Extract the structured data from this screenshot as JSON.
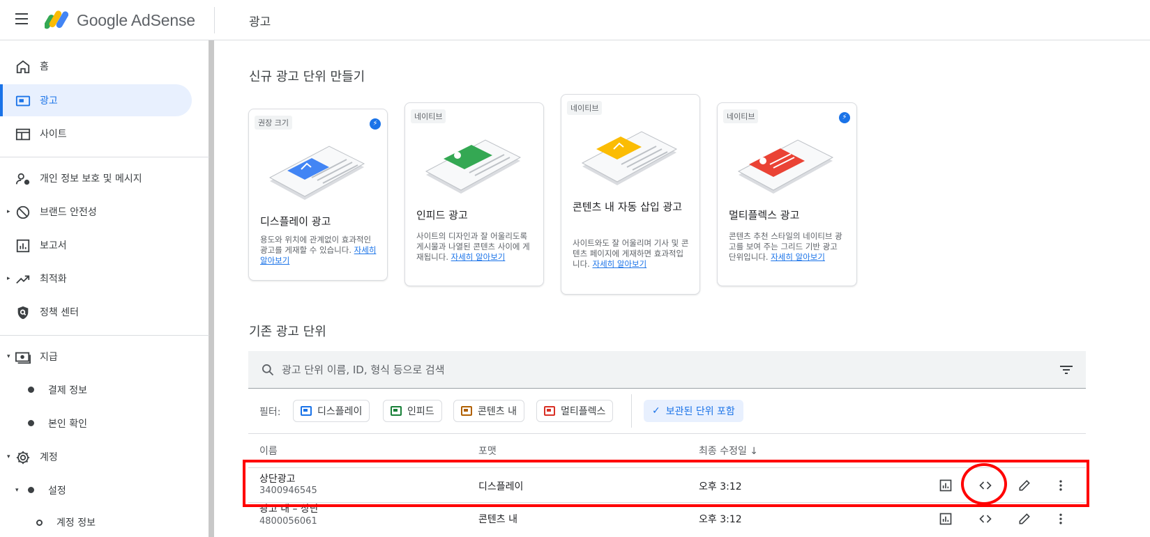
{
  "header": {
    "brand": "Google AdSense",
    "page_title": "광고"
  },
  "sidebar": {
    "items": [
      {
        "label": "홈",
        "icon": "home-icon"
      },
      {
        "label": "광고",
        "icon": "ads-icon",
        "active": true
      },
      {
        "label": "사이트",
        "icon": "sites-icon"
      },
      {
        "label": "개인 정보 보호 및 메시지",
        "icon": "privacy-icon"
      },
      {
        "label": "브랜드 안전성",
        "icon": "block-icon"
      },
      {
        "label": "보고서",
        "icon": "reports-icon"
      },
      {
        "label": "최적화",
        "icon": "trending-icon"
      },
      {
        "label": "정책 센터",
        "icon": "shield-icon"
      },
      {
        "label": "지급",
        "icon": "payments-icon"
      },
      {
        "label": "결제 정보",
        "icon": "bullet-icon"
      },
      {
        "label": "본인 확인",
        "icon": "bullet-icon"
      },
      {
        "label": "계정",
        "icon": "gear-icon"
      },
      {
        "label": "설정",
        "icon": "bullet-icon"
      },
      {
        "label": "계정 정보",
        "icon": "ring-icon"
      }
    ]
  },
  "new_units": {
    "title": "신규 광고 단위 만들기",
    "cards": [
      {
        "tag": "권장 크기",
        "title": "디스플레이 광고",
        "desc": "용도와 위치에 관계없이 효과적인 광고를 게재할 수 있습니다.",
        "link": "자세히 알아보기",
        "accent": "#4285f4"
      },
      {
        "tag": "네이티브",
        "title": "인피드 광고",
        "desc": "사이트의 디자인과 잘 어울리도록 게시물과 나열된 콘텐츠 사이에 게재됩니다.",
        "link": "자세히 알아보기",
        "accent": "#34a853"
      },
      {
        "tag": "네이티브",
        "title": "콘텐츠 내 자동 삽입 광고",
        "desc": "사이트와도 잘 어울리며 기사 및 콘텐츠 페이지에 게재하면 효과적입니다.",
        "link": "자세히 알아보기",
        "accent": "#fbbc04"
      },
      {
        "tag": "네이티브",
        "title": "멀티플렉스 광고",
        "desc": "콘텐츠 추천 스타일의 네이티브 광고를 보여 주는 그리드 기반 광고 단위입니다.",
        "link": "자세히 알아보기",
        "accent": "#ea4335"
      }
    ]
  },
  "existing_units": {
    "title": "기존 광고 단위",
    "search_placeholder": "광고 단위 이름, ID, 형식 등으로 검색",
    "filter_label": "필터:",
    "chips": [
      {
        "label": "디스플레이",
        "color": "#1a73e8"
      },
      {
        "label": "인피드",
        "color": "#188038"
      },
      {
        "label": "콘텐츠 내",
        "color": "#b06000"
      },
      {
        "label": "멀티플렉스",
        "color": "#d93025"
      }
    ],
    "archived_chip": "보관된 단위 포함",
    "columns": {
      "name": "이름",
      "format": "포맷",
      "modified": "최종 수정일 ↓"
    },
    "rows": [
      {
        "name": "상단광고",
        "id": "3400946545",
        "format": "디스플레이",
        "modified": "오후 3:12"
      },
      {
        "name": "광고 내 – 상단",
        "id": "4800056061",
        "format": "콘텐츠 내",
        "modified": "오후 3:12"
      }
    ]
  }
}
